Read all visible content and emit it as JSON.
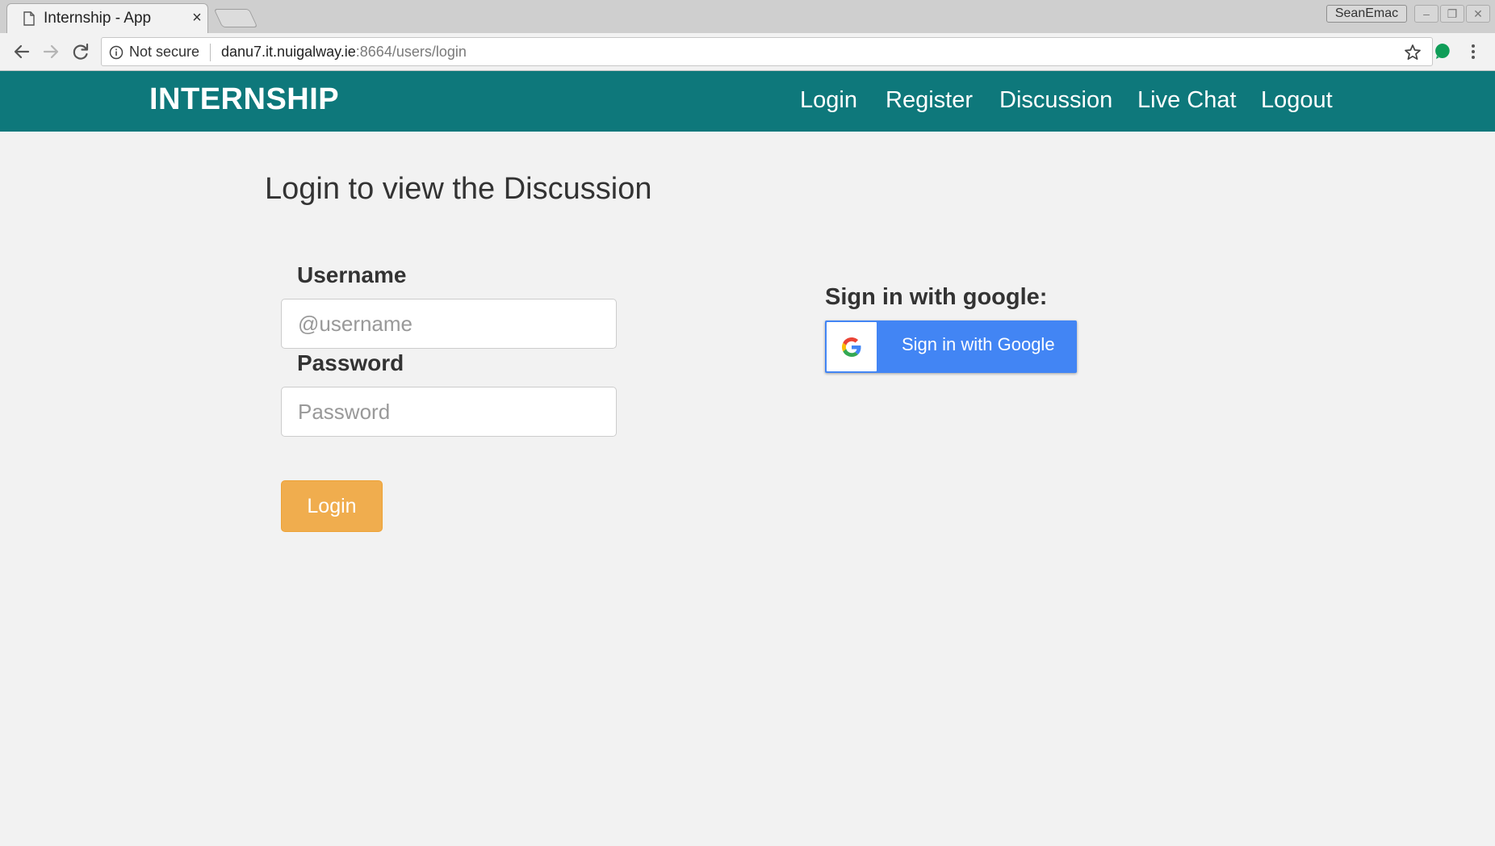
{
  "browser": {
    "tab_title": "Internship - App",
    "tab_close": "×",
    "profile_name": "SeanEmac",
    "window_controls": {
      "minimize": "–",
      "restore": "❐",
      "close": "✕"
    },
    "security_label": "Not secure",
    "url_host": "danu7.it.nuigalway.ie",
    "url_rest": ":8664/users/login",
    "extension_color": "#0f9d58"
  },
  "navbar": {
    "brand": "INTERNSHIP",
    "links": [
      "Login",
      "Register",
      "Discussion",
      "Live Chat",
      "Logout"
    ],
    "background_color": "#0e787b"
  },
  "page": {
    "heading": "Login to view the Discussion",
    "username_label": "Username",
    "username_placeholder": "@username",
    "password_label": "Password",
    "password_placeholder": "Password",
    "login_button": "Login",
    "google_heading": "Sign in with google:",
    "google_button": "Sign in with Google",
    "accent_color": "#f0ad4e",
    "google_color": "#4285f4"
  }
}
